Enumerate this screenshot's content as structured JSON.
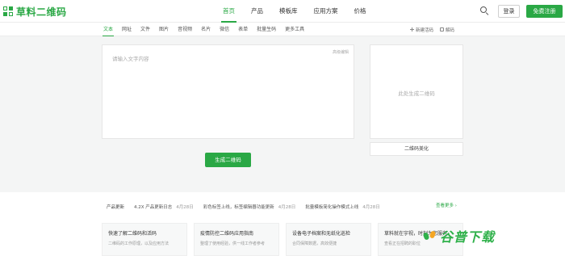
{
  "brand": {
    "name": "草料二维码",
    "accent": "#2aa845"
  },
  "nav": {
    "items": [
      "首页",
      "产品",
      "模板库",
      "应用方案",
      "价格"
    ],
    "active_index": 0,
    "login": "登录",
    "register": "免费注册"
  },
  "tabs": {
    "items": [
      "文本",
      "网址",
      "文件",
      "图片",
      "音视频",
      "名片",
      "微信",
      "表单",
      "批量生码",
      "更多工具"
    ],
    "active_index": 0,
    "actions": [
      "新建活码",
      "解码"
    ]
  },
  "editor": {
    "placeholder": "请输入文字内容",
    "hint": "高级编辑"
  },
  "preview": {
    "placeholder": "此处生成二维码",
    "beautify": "二维码美化"
  },
  "generate_button": "生成二维码",
  "news": {
    "label": "产品更新",
    "items": [
      {
        "text": "4.2X 产品更新日志",
        "date": "4月28日"
      },
      {
        "text": "彩色标签上线，标签编辑器功能更新",
        "date": "4月28日"
      },
      {
        "text": "批量模板简化操作模式上线",
        "date": "4月28日"
      }
    ],
    "more": "查看更多 ›"
  },
  "cards": [
    {
      "title": "快速了解二维码和活码",
      "desc": "二维码的工作原理，以及应用方法"
    },
    {
      "title": "疫情防控二维码应用指南",
      "desc": "整理了使用经验，供一线工作者参考"
    },
    {
      "title": "设备电子档案和无纸化巡检",
      "desc": "合同保障数据，高效便捷"
    },
    {
      "title": "草料就在宇视，时刻为您服务",
      "desc": "查看正在招聘的职位"
    }
  ],
  "watermark": {
    "text": "谷普下载"
  }
}
